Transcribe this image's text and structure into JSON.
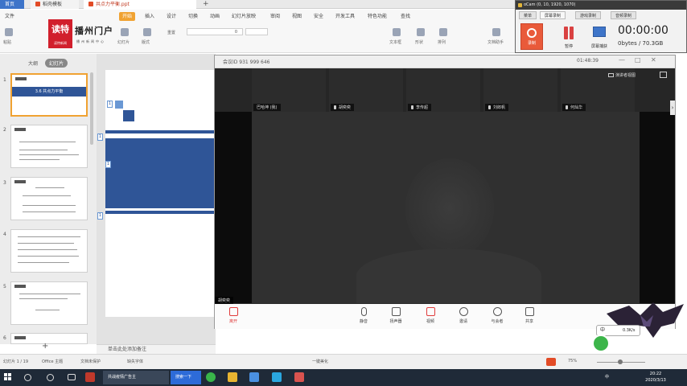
{
  "wps": {
    "tabs": [
      "首页",
      "稻壳模板",
      "共点力平衡.ppt"
    ],
    "menu": [
      "文件",
      "开始",
      "插入",
      "设计",
      "切换",
      "动画",
      "幻灯片放映",
      "审阅",
      "视图",
      "安全",
      "开发工具",
      "特色功能",
      "查找"
    ],
    "active_menu_index": 1,
    "ribbon_labels": [
      "粘贴",
      "幻灯片",
      "版式",
      "重置",
      "文本框",
      "形状",
      "排列",
      "文档助手"
    ],
    "font_size_value": "0",
    "panel_tabs": [
      "大纲",
      "幻灯片"
    ],
    "thumb_numbers": [
      "1",
      "2",
      "3",
      "4",
      "5",
      "6"
    ],
    "thumb1_title": "3.6 共点力平衡",
    "slide_markers": [
      "1",
      "1",
      "1",
      "1"
    ],
    "notes_placeholder": "单击此处添加备注",
    "status": {
      "slide": "幻灯片 1 / 19",
      "theme": "Office 主题",
      "protect": "文档未保护",
      "font": "缺失字体",
      "beautify": "一键美化",
      "zoom": "75%"
    }
  },
  "logo": {
    "mark": "读特",
    "mark_sub": "读特新闻",
    "name": "播州门户",
    "sub": "播州新闻中心"
  },
  "meeting": {
    "title": "会议ID 931 999 646",
    "time": "01:48:39",
    "presenter_view": "演讲者视图",
    "participants": [
      "巴哈坤 (我)",
      "胡奕奕",
      "李传超",
      "刘郎帆",
      "何灿华"
    ],
    "self_label": "胡奕奕",
    "toolbar": [
      "离开",
      "静音",
      "扬声器",
      "视频",
      "邀请",
      "与会者",
      "共享"
    ],
    "accent": "#e03c3c"
  },
  "ocam": {
    "title": "oCam (0, 10, 1920, 1070)",
    "tabs": [
      "菜单",
      "屏幕录制",
      "游戏录制",
      "音频录制"
    ],
    "active_tab_index": 1,
    "buttons": [
      "录制",
      "暂停",
      "屏幕捕获"
    ],
    "timer": "00:00:00",
    "size": "0bytes / 70.3GB",
    "record_color": "#e95a3a"
  },
  "ime": {
    "label": "中",
    "net": "0.3K/s"
  },
  "taskbar": {
    "tasks": [
      "共战疫情广告主",
      "搜索一下"
    ],
    "time": "20:22",
    "date": "2020/3/13",
    "lang": "中"
  }
}
